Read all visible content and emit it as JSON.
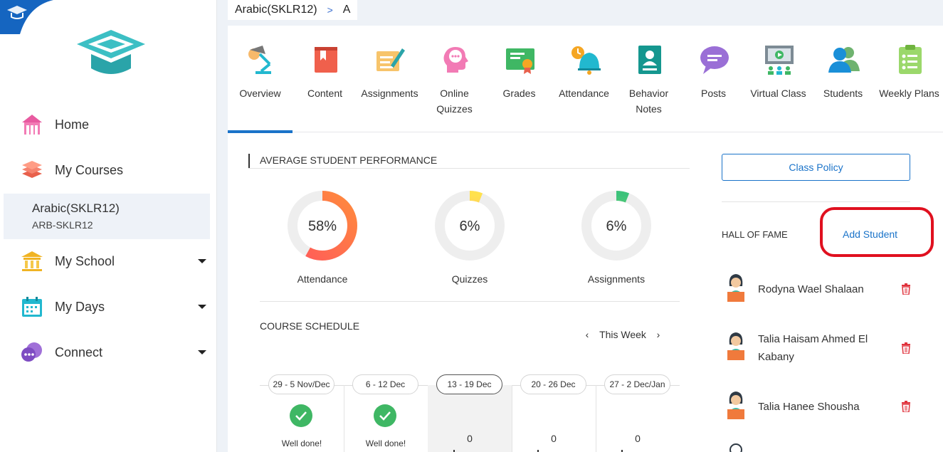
{
  "breadcrumb": {
    "course": "Arabic(SKLR12)",
    "separator": ">",
    "section": "A"
  },
  "sidebar": {
    "items": [
      {
        "label": "Home",
        "icon": "home-icon"
      },
      {
        "label": "My Courses",
        "icon": "books-icon"
      },
      {
        "label": "My School",
        "icon": "school-building-icon"
      },
      {
        "label": "My Days",
        "icon": "calendar-icon"
      },
      {
        "label": "Connect",
        "icon": "chat-bubbles-icon"
      }
    ],
    "active_course": {
      "name": "Arabic(SKLR12)",
      "code": "ARB-SKLR12"
    }
  },
  "tabs": [
    {
      "label": "Overview",
      "icon": "desk-lamp-icon"
    },
    {
      "label": "Content",
      "icon": "book-icon"
    },
    {
      "label": "Assignments",
      "icon": "pen-paper-icon"
    },
    {
      "label": "Online Quizzes",
      "icon": "head-chat-icon"
    },
    {
      "label": "Grades",
      "icon": "certificate-icon"
    },
    {
      "label": "Attendance",
      "icon": "bell-clock-icon"
    },
    {
      "label": "Behavior Notes",
      "icon": "id-card-icon"
    },
    {
      "label": "Posts",
      "icon": "speech-bubble-icon"
    },
    {
      "label": "Virtual Class",
      "icon": "presentation-icon"
    },
    {
      "label": "Students",
      "icon": "students-icon"
    },
    {
      "label": "Weekly Plans",
      "icon": "clipboard-list-icon"
    }
  ],
  "performance": {
    "title": "AVERAGE STUDENT PERFORMANCE",
    "metrics": [
      {
        "label": "Attendance",
        "value": "58%",
        "percent": 58,
        "color_start": "#ff7a4d",
        "color_end": "#ff5a5a"
      },
      {
        "label": "Quizzes",
        "value": "6%",
        "percent": 6,
        "color_start": "#ff8fa3",
        "color_end": "#ffe14d"
      },
      {
        "label": "Assignments",
        "value": "6%",
        "percent": 6,
        "color_start": "#d8f06a",
        "color_end": "#3cc27a"
      }
    ]
  },
  "schedule": {
    "title": "COURSE SCHEDULE",
    "nav": {
      "prev": "‹",
      "label": "This Week",
      "next": "›"
    },
    "weeks": [
      {
        "range": "29 - 5 Nov/Dec",
        "status": "Well done!",
        "done": true
      },
      {
        "range": "6 - 12 Dec",
        "status": "Well done!",
        "done": true
      },
      {
        "range": "13 - 19 Dec",
        "count": "0",
        "active": true
      },
      {
        "range": "20 - 26 Dec",
        "count": "0"
      },
      {
        "range": "27 - 2 Dec/Jan",
        "count": "0"
      }
    ]
  },
  "right": {
    "class_policy": "Class Policy",
    "hof_title": "HALL OF FAME",
    "add_student": "Add Student",
    "students": [
      {
        "name": "Rodyna Wael Shalaan"
      },
      {
        "name": "Talia Haisam Ahmed El Kabany"
      },
      {
        "name": "Talia Hanee Shousha"
      }
    ]
  },
  "colors": {
    "accent": "#1a73c9",
    "highlight_box": "#e0101f",
    "success": "#3fb764",
    "trash": "#e0323c"
  }
}
